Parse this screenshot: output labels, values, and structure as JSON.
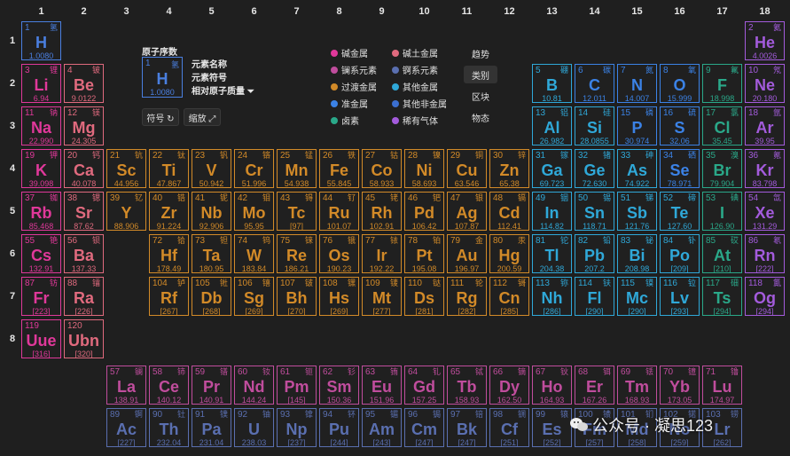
{
  "columns": [
    "1",
    "2",
    "3",
    "4",
    "5",
    "6",
    "7",
    "8",
    "9",
    "10",
    "11",
    "12",
    "13",
    "14",
    "15",
    "16",
    "17",
    "18"
  ],
  "rows": [
    "1",
    "2",
    "3",
    "4",
    "5",
    "6",
    "7",
    "8"
  ],
  "colors": {
    "alkali": "#e0389a",
    "alkaline": "#e06a7e",
    "transition": "#d28a28",
    "post": "#2fa8d8",
    "metalloid": "#2fa8d8",
    "nonmetal": "#3b82e6",
    "halogen": "#2aa889",
    "noble": "#a35bdc",
    "lanthanide": "#c04d9d",
    "actinide": "#5a6fb0",
    "unknown": "#e0389a",
    "hydrogen": "#4a7fe0"
  },
  "key_card": {
    "title": "原子序数",
    "number": "1",
    "cn": "氢",
    "symbol": "H",
    "mass": "1.0080",
    "name_label": "元素名称",
    "symbol_label": "元素符号",
    "mass_label": "相对原子质量 ⏷"
  },
  "buttons": {
    "symbol": "符号 ↻",
    "zoom": "缩放 ⤢"
  },
  "legend": [
    {
      "label": "碱金属",
      "color": "#e0389a"
    },
    {
      "label": "碱土金属",
      "color": "#e06a7e"
    },
    {
      "label": "镧系元素",
      "color": "#c04d9d"
    },
    {
      "label": "锕系元素",
      "color": "#5a6fb0"
    },
    {
      "label": "过渡金属",
      "color": "#d28a28"
    },
    {
      "label": "其他金属",
      "color": "#2fa8d8"
    },
    {
      "label": "准金属",
      "color": "#3b82e6"
    },
    {
      "label": "其他非金属",
      "color": "#3b6fd0"
    },
    {
      "label": "卤素",
      "color": "#2aa889"
    },
    {
      "label": "稀有气体",
      "color": "#a35bdc"
    }
  ],
  "view_buttons": [
    "趋势",
    "类别",
    "区块",
    "物态"
  ],
  "watermark": "公众号 · 凝思123",
  "elements": [
    {
      "n": "1",
      "cn": "氢",
      "s": "H",
      "m": "1.0080",
      "c": "hydrogen"
    },
    {
      "n": "2",
      "cn": "氦",
      "s": "He",
      "m": "4.0026",
      "c": "noble"
    },
    {
      "n": "3",
      "cn": "锂",
      "s": "Li",
      "m": "6.94",
      "c": "alkali"
    },
    {
      "n": "4",
      "cn": "铍",
      "s": "Be",
      "m": "9.0122",
      "c": "alkaline"
    },
    {
      "n": "5",
      "cn": "硼",
      "s": "B",
      "m": "10.81",
      "c": "metalloid"
    },
    {
      "n": "6",
      "cn": "碳",
      "s": "C",
      "m": "12.011",
      "c": "nonmetal"
    },
    {
      "n": "7",
      "cn": "氮",
      "s": "N",
      "m": "14.007",
      "c": "nonmetal"
    },
    {
      "n": "8",
      "cn": "氧",
      "s": "O",
      "m": "15.999",
      "c": "nonmetal"
    },
    {
      "n": "9",
      "cn": "氟",
      "s": "F",
      "m": "18.998",
      "c": "halogen"
    },
    {
      "n": "10",
      "cn": "氖",
      "s": "Ne",
      "m": "20.180",
      "c": "noble"
    },
    {
      "n": "11",
      "cn": "钠",
      "s": "Na",
      "m": "22.990",
      "c": "alkali"
    },
    {
      "n": "12",
      "cn": "镁",
      "s": "Mg",
      "m": "24.305",
      "c": "alkaline"
    },
    {
      "n": "13",
      "cn": "铝",
      "s": "Al",
      "m": "26.982",
      "c": "post"
    },
    {
      "n": "14",
      "cn": "硅",
      "s": "Si",
      "m": "28.0855",
      "c": "metalloid"
    },
    {
      "n": "15",
      "cn": "磷",
      "s": "P",
      "m": "30.974",
      "c": "nonmetal"
    },
    {
      "n": "16",
      "cn": "硫",
      "s": "S",
      "m": "32.06",
      "c": "nonmetal"
    },
    {
      "n": "17",
      "cn": "氯",
      "s": "Cl",
      "m": "35.45",
      "c": "halogen"
    },
    {
      "n": "18",
      "cn": "氩",
      "s": "Ar",
      "m": "39.95",
      "c": "noble"
    },
    {
      "n": "19",
      "cn": "钾",
      "s": "K",
      "m": "39.098",
      "c": "alkali"
    },
    {
      "n": "20",
      "cn": "钙",
      "s": "Ca",
      "m": "40.078",
      "c": "alkaline"
    },
    {
      "n": "21",
      "cn": "钪",
      "s": "Sc",
      "m": "44.956",
      "c": "transition"
    },
    {
      "n": "22",
      "cn": "钛",
      "s": "Ti",
      "m": "47.867",
      "c": "transition"
    },
    {
      "n": "23",
      "cn": "钒",
      "s": "V",
      "m": "50.942",
      "c": "transition"
    },
    {
      "n": "24",
      "cn": "铬",
      "s": "Cr",
      "m": "51.996",
      "c": "transition"
    },
    {
      "n": "25",
      "cn": "锰",
      "s": "Mn",
      "m": "54.938",
      "c": "transition"
    },
    {
      "n": "26",
      "cn": "铁",
      "s": "Fe",
      "m": "55.845",
      "c": "transition"
    },
    {
      "n": "27",
      "cn": "钴",
      "s": "Co",
      "m": "58.933",
      "c": "transition"
    },
    {
      "n": "28",
      "cn": "镍",
      "s": "Ni",
      "m": "58.693",
      "c": "transition"
    },
    {
      "n": "29",
      "cn": "铜",
      "s": "Cu",
      "m": "63.546",
      "c": "transition"
    },
    {
      "n": "30",
      "cn": "锌",
      "s": "Zn",
      "m": "65.38",
      "c": "transition"
    },
    {
      "n": "31",
      "cn": "镓",
      "s": "Ga",
      "m": "69.723",
      "c": "post"
    },
    {
      "n": "32",
      "cn": "锗",
      "s": "Ge",
      "m": "72.630",
      "c": "metalloid"
    },
    {
      "n": "33",
      "cn": "砷",
      "s": "As",
      "m": "74.922",
      "c": "metalloid"
    },
    {
      "n": "34",
      "cn": "硒",
      "s": "Se",
      "m": "78.971",
      "c": "nonmetal"
    },
    {
      "n": "35",
      "cn": "溴",
      "s": "Br",
      "m": "79.904",
      "c": "halogen"
    },
    {
      "n": "36",
      "cn": "氪",
      "s": "Kr",
      "m": "83.798",
      "c": "noble"
    },
    {
      "n": "37",
      "cn": "铷",
      "s": "Rb",
      "m": "85.468",
      "c": "alkali"
    },
    {
      "n": "38",
      "cn": "锶",
      "s": "Sr",
      "m": "87.62",
      "c": "alkaline"
    },
    {
      "n": "39",
      "cn": "钇",
      "s": "Y",
      "m": "88.906",
      "c": "transition"
    },
    {
      "n": "40",
      "cn": "锆",
      "s": "Zr",
      "m": "91.224",
      "c": "transition"
    },
    {
      "n": "41",
      "cn": "铌",
      "s": "Nb",
      "m": "92.906",
      "c": "transition"
    },
    {
      "n": "42",
      "cn": "钼",
      "s": "Mo",
      "m": "95.95",
      "c": "transition"
    },
    {
      "n": "43",
      "cn": "锝",
      "s": "Tc",
      "m": "[97]",
      "c": "transition"
    },
    {
      "n": "44",
      "cn": "钌",
      "s": "Ru",
      "m": "101.07",
      "c": "transition"
    },
    {
      "n": "45",
      "cn": "铑",
      "s": "Rh",
      "m": "102.91",
      "c": "transition"
    },
    {
      "n": "46",
      "cn": "钯",
      "s": "Pd",
      "m": "106.42",
      "c": "transition"
    },
    {
      "n": "47",
      "cn": "银",
      "s": "Ag",
      "m": "107.87",
      "c": "transition"
    },
    {
      "n": "48",
      "cn": "镉",
      "s": "Cd",
      "m": "112.41",
      "c": "transition"
    },
    {
      "n": "49",
      "cn": "铟",
      "s": "In",
      "m": "114.82",
      "c": "post"
    },
    {
      "n": "50",
      "cn": "锡",
      "s": "Sn",
      "m": "118.71",
      "c": "post"
    },
    {
      "n": "51",
      "cn": "锑",
      "s": "Sb",
      "m": "121.76",
      "c": "metalloid"
    },
    {
      "n": "52",
      "cn": "碲",
      "s": "Te",
      "m": "127.60",
      "c": "metalloid"
    },
    {
      "n": "53",
      "cn": "碘",
      "s": "I",
      "m": "126.90",
      "c": "halogen"
    },
    {
      "n": "54",
      "cn": "氙",
      "s": "Xe",
      "m": "131.29",
      "c": "noble"
    },
    {
      "n": "55",
      "cn": "铯",
      "s": "Cs",
      "m": "132.91",
      "c": "alkali"
    },
    {
      "n": "56",
      "cn": "钡",
      "s": "Ba",
      "m": "137.33",
      "c": "alkaline"
    },
    {
      "n": "72",
      "cn": "铪",
      "s": "Hf",
      "m": "178.49",
      "c": "transition"
    },
    {
      "n": "73",
      "cn": "钽",
      "s": "Ta",
      "m": "180.95",
      "c": "transition"
    },
    {
      "n": "74",
      "cn": "钨",
      "s": "W",
      "m": "183.84",
      "c": "transition"
    },
    {
      "n": "75",
      "cn": "铼",
      "s": "Re",
      "m": "186.21",
      "c": "transition"
    },
    {
      "n": "76",
      "cn": "锇",
      "s": "Os",
      "m": "190.23",
      "c": "transition"
    },
    {
      "n": "77",
      "cn": "铱",
      "s": "Ir",
      "m": "192.22",
      "c": "transition"
    },
    {
      "n": "78",
      "cn": "铂",
      "s": "Pt",
      "m": "195.08",
      "c": "transition"
    },
    {
      "n": "79",
      "cn": "金",
      "s": "Au",
      "m": "196.97",
      "c": "transition"
    },
    {
      "n": "80",
      "cn": "汞",
      "s": "Hg",
      "m": "200.59",
      "c": "transition"
    },
    {
      "n": "81",
      "cn": "铊",
      "s": "Tl",
      "m": "204.38",
      "c": "post"
    },
    {
      "n": "82",
      "cn": "铅",
      "s": "Pb",
      "m": "207.2",
      "c": "post"
    },
    {
      "n": "83",
      "cn": "铋",
      "s": "Bi",
      "m": "208.98",
      "c": "post"
    },
    {
      "n": "84",
      "cn": "钋",
      "s": "Po",
      "m": "[209]",
      "c": "post"
    },
    {
      "n": "85",
      "cn": "砹",
      "s": "At",
      "m": "[210]",
      "c": "halogen"
    },
    {
      "n": "86",
      "cn": "氡",
      "s": "Rn",
      "m": "[222]",
      "c": "noble"
    },
    {
      "n": "87",
      "cn": "钫",
      "s": "Fr",
      "m": "[223]",
      "c": "alkali"
    },
    {
      "n": "88",
      "cn": "镭",
      "s": "Ra",
      "m": "[226]",
      "c": "alkaline"
    },
    {
      "n": "104",
      "cn": "𬬻",
      "s": "Rf",
      "m": "[267]",
      "c": "transition"
    },
    {
      "n": "105",
      "cn": "𬭊",
      "s": "Db",
      "m": "[268]",
      "c": "transition"
    },
    {
      "n": "106",
      "cn": "𬭳",
      "s": "Sg",
      "m": "[269]",
      "c": "transition"
    },
    {
      "n": "107",
      "cn": "𬭛",
      "s": "Bh",
      "m": "[270]",
      "c": "transition"
    },
    {
      "n": "108",
      "cn": "𬭶",
      "s": "Hs",
      "m": "[269]",
      "c": "transition"
    },
    {
      "n": "109",
      "cn": "鿏",
      "s": "Mt",
      "m": "[277]",
      "c": "transition"
    },
    {
      "n": "110",
      "cn": "𫟼",
      "s": "Ds",
      "m": "[281]",
      "c": "transition"
    },
    {
      "n": "111",
      "cn": "𬬭",
      "s": "Rg",
      "m": "[282]",
      "c": "transition"
    },
    {
      "n": "112",
      "cn": "鿔",
      "s": "Cn",
      "m": "[285]",
      "c": "transition"
    },
    {
      "n": "113",
      "cn": "鿭",
      "s": "Nh",
      "m": "[286]",
      "c": "post"
    },
    {
      "n": "114",
      "cn": "𫓧",
      "s": "Fl",
      "m": "[290]",
      "c": "post"
    },
    {
      "n": "115",
      "cn": "镆",
      "s": "Mc",
      "m": "[290]",
      "c": "post"
    },
    {
      "n": "116",
      "cn": "𫟷",
      "s": "Lv",
      "m": "[293]",
      "c": "post"
    },
    {
      "n": "117",
      "cn": "鿬",
      "s": "Ts",
      "m": "[294]",
      "c": "halogen"
    },
    {
      "n": "118",
      "cn": "鿫",
      "s": "Og",
      "m": "[294]",
      "c": "noble"
    },
    {
      "n": "119",
      "cn": "",
      "s": "Uue",
      "m": "[316]",
      "c": "unknown"
    },
    {
      "n": "120",
      "cn": "",
      "s": "Ubn",
      "m": "[320]",
      "c": "alkaline"
    },
    {
      "n": "57",
      "cn": "镧",
      "s": "La",
      "m": "138.91",
      "c": "lanthanide"
    },
    {
      "n": "58",
      "cn": "铈",
      "s": "Ce",
      "m": "140.12",
      "c": "lanthanide"
    },
    {
      "n": "59",
      "cn": "镨",
      "s": "Pr",
      "m": "140.91",
      "c": "lanthanide"
    },
    {
      "n": "60",
      "cn": "钕",
      "s": "Nd",
      "m": "144.24",
      "c": "lanthanide"
    },
    {
      "n": "61",
      "cn": "钷",
      "s": "Pm",
      "m": "[145]",
      "c": "lanthanide"
    },
    {
      "n": "62",
      "cn": "钐",
      "s": "Sm",
      "m": "150.36",
      "c": "lanthanide"
    },
    {
      "n": "63",
      "cn": "铕",
      "s": "Eu",
      "m": "151.96",
      "c": "lanthanide"
    },
    {
      "n": "64",
      "cn": "钆",
      "s": "Gd",
      "m": "157.25",
      "c": "lanthanide"
    },
    {
      "n": "65",
      "cn": "铽",
      "s": "Tb",
      "m": "158.93",
      "c": "lanthanide"
    },
    {
      "n": "66",
      "cn": "镝",
      "s": "Dy",
      "m": "162.50",
      "c": "lanthanide"
    },
    {
      "n": "67",
      "cn": "钬",
      "s": "Ho",
      "m": "164.93",
      "c": "lanthanide"
    },
    {
      "n": "68",
      "cn": "铒",
      "s": "Er",
      "m": "167.26",
      "c": "lanthanide"
    },
    {
      "n": "69",
      "cn": "铥",
      "s": "Tm",
      "m": "168.93",
      "c": "lanthanide"
    },
    {
      "n": "70",
      "cn": "镱",
      "s": "Yb",
      "m": "173.05",
      "c": "lanthanide"
    },
    {
      "n": "71",
      "cn": "镥",
      "s": "Lu",
      "m": "174.97",
      "c": "lanthanide"
    },
    {
      "n": "89",
      "cn": "锕",
      "s": "Ac",
      "m": "[227]",
      "c": "actinide"
    },
    {
      "n": "90",
      "cn": "钍",
      "s": "Th",
      "m": "232.04",
      "c": "actinide"
    },
    {
      "n": "91",
      "cn": "镤",
      "s": "Pa",
      "m": "231.04",
      "c": "actinide"
    },
    {
      "n": "92",
      "cn": "铀",
      "s": "U",
      "m": "238.03",
      "c": "actinide"
    },
    {
      "n": "93",
      "cn": "镎",
      "s": "Np",
      "m": "[237]",
      "c": "actinide"
    },
    {
      "n": "94",
      "cn": "钚",
      "s": "Pu",
      "m": "[244]",
      "c": "actinide"
    },
    {
      "n": "95",
      "cn": "镅",
      "s": "Am",
      "m": "[243]",
      "c": "actinide"
    },
    {
      "n": "96",
      "cn": "锔",
      "s": "Cm",
      "m": "[247]",
      "c": "actinide"
    },
    {
      "n": "97",
      "cn": "锫",
      "s": "Bk",
      "m": "[247]",
      "c": "actinide"
    },
    {
      "n": "98",
      "cn": "锎",
      "s": "Cf",
      "m": "[251]",
      "c": "actinide"
    },
    {
      "n": "99",
      "cn": "锿",
      "s": "Es",
      "m": "[252]",
      "c": "actinide"
    },
    {
      "n": "100",
      "cn": "镄",
      "s": "Fm",
      "m": "[257]",
      "c": "actinide"
    },
    {
      "n": "101",
      "cn": "钔",
      "s": "Md",
      "m": "[258]",
      "c": "actinide"
    },
    {
      "n": "102",
      "cn": "锘",
      "s": "No",
      "m": "[259]",
      "c": "actinide"
    },
    {
      "n": "103",
      "cn": "铹",
      "s": "Lr",
      "m": "[262]",
      "c": "actinide"
    }
  ]
}
